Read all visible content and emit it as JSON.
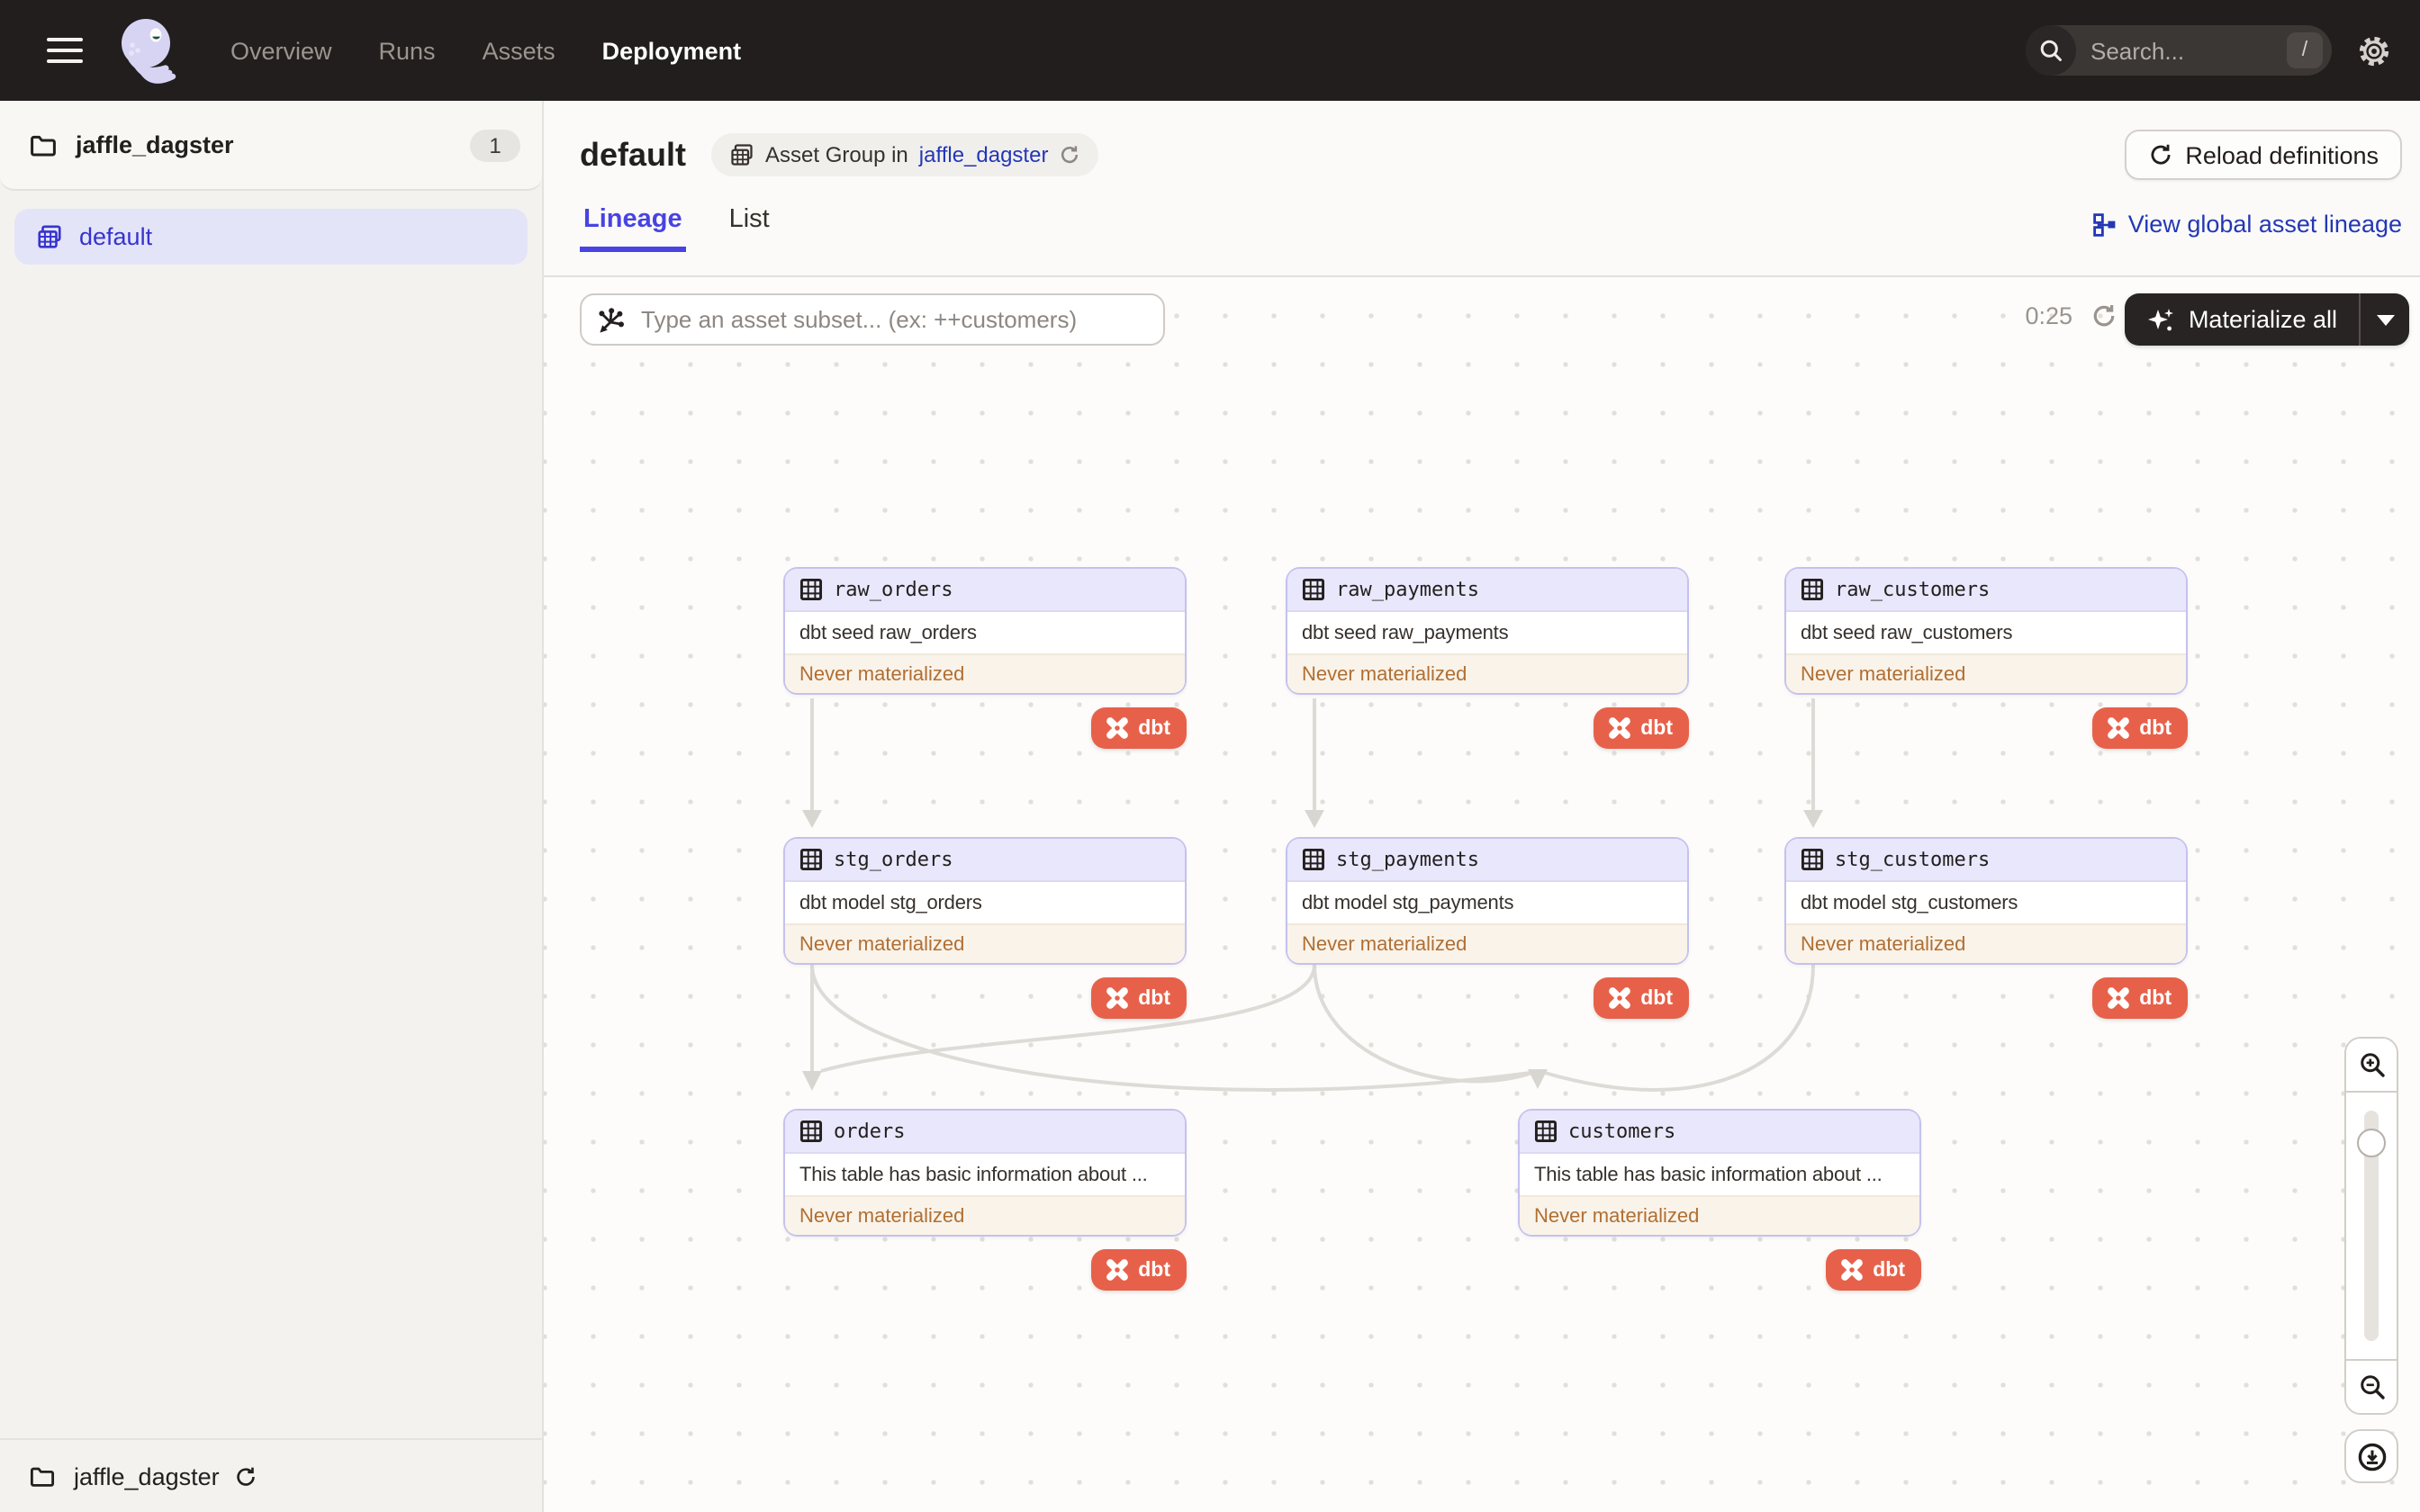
{
  "nav": {
    "menu": [
      {
        "label": "Overview"
      },
      {
        "label": "Runs"
      },
      {
        "label": "Assets"
      },
      {
        "label": "Deployment"
      }
    ],
    "search": {
      "placeholder": "Search...",
      "shortcut": "/"
    }
  },
  "sidebar": {
    "repo": {
      "name": "jaffle_dagster",
      "count": "1"
    },
    "groups": [
      {
        "label": "default"
      }
    ],
    "footer": {
      "repo_name": "jaffle_dagster"
    }
  },
  "header": {
    "title": "default",
    "tag": {
      "prefix": "Asset Group in",
      "link": "jaffle_dagster"
    },
    "reload_button": "Reload definitions"
  },
  "tabs": {
    "lineage": "Lineage",
    "list": "List"
  },
  "global_lineage_link": "View global asset lineage",
  "toolbar": {
    "filter_placeholder": "Type an asset subset... (ex: ++customers)",
    "timer": "0:25",
    "materialize": "Materialize all"
  },
  "graph": {
    "nodes": [
      {
        "name": "raw_orders",
        "desc": "dbt seed raw_orders",
        "status": "Never materialized",
        "badge": "dbt"
      },
      {
        "name": "raw_payments",
        "desc": "dbt seed raw_payments",
        "status": "Never materialized",
        "badge": "dbt"
      },
      {
        "name": "raw_customers",
        "desc": "dbt seed raw_customers",
        "status": "Never materialized",
        "badge": "dbt"
      },
      {
        "name": "stg_orders",
        "desc": "dbt model stg_orders",
        "status": "Never materialized",
        "badge": "dbt"
      },
      {
        "name": "stg_payments",
        "desc": "dbt model stg_payments",
        "status": "Never materialized",
        "badge": "dbt"
      },
      {
        "name": "stg_customers",
        "desc": "dbt model stg_customers",
        "status": "Never materialized",
        "badge": "dbt"
      },
      {
        "name": "orders",
        "desc": "This table has basic information about ...",
        "status": "Never materialized",
        "badge": "dbt"
      },
      {
        "name": "customers",
        "desc": "This table has basic information about ...",
        "status": "Never materialized",
        "badge": "dbt"
      }
    ]
  },
  "colors": {
    "accent_blue": "#4843e2",
    "link_blue": "#2337b7",
    "dbt_orange": "#e7614a",
    "status_text": "#b06f33",
    "node_border": "#c5c1ee",
    "nav_bg": "#221e1d"
  }
}
